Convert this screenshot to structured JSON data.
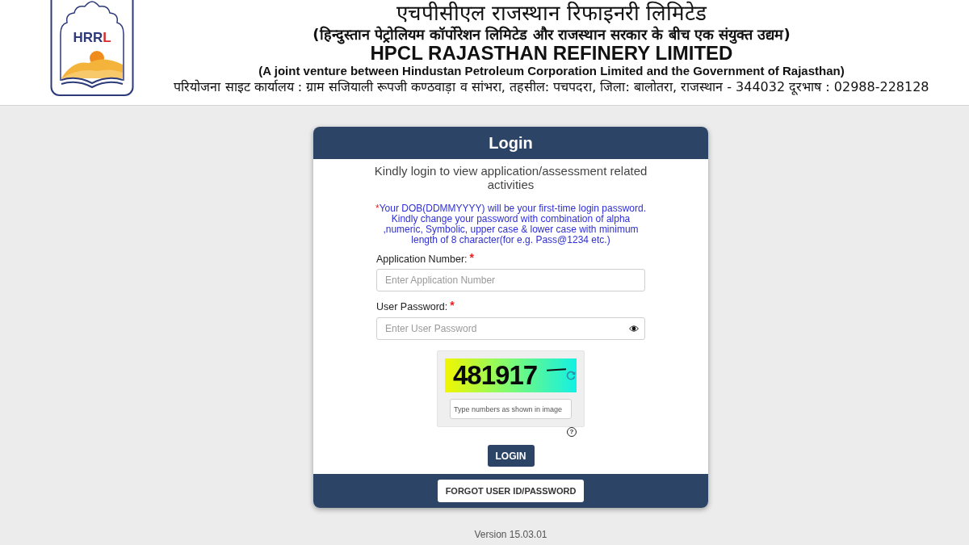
{
  "header": {
    "logo": {
      "text_parts": [
        {
          "text": "HRR",
          "color": "#2e3b7a"
        },
        {
          "text": "L",
          "color": "#d92b2b"
        }
      ]
    },
    "lines": [
      {
        "kind": "hindi_title",
        "text": "एचपीसीएल राजस्थान रिफाइनरी लिमिटेड"
      },
      {
        "kind": "hindi_subtitle",
        "text": "(हिन्दुस्तान पेट्रोलियम कॉर्पोरेशन लिमिटेड और राजस्थान सरकार के बीच एक संयुक्त उद्यम)"
      },
      {
        "kind": "english_title",
        "text": "HPCL RAJASTHAN REFINERY LIMITED"
      },
      {
        "kind": "english_subtitle",
        "text": "(A joint venture between Hindustan Petroleum Corporation Limited and the Government of Rajasthan)"
      },
      {
        "kind": "address",
        "text": "परियोजना साइट कार्यालय : ग्राम सजियाली रूपजी कण्ठवाड़ा व सांभरा, तहसील: पचपदरा, जिला: बालोतरा, राजस्थान - 344032  दूरभाष : 02988-228128"
      }
    ]
  },
  "login": {
    "title": "Login",
    "intro": "Kindly login to view application/assessment related activities",
    "note": {
      "marker": "*",
      "text": "Your DOB(DDMMYYYY) will be your first-time login password. Kindly change your password with combination of alpha ,numeric, Symbolic, upper case & lower case with minimum length of 8 character(for e.g. Pass@1234 etc.)"
    },
    "fields": [
      {
        "kind": "text",
        "label": "Application Number:",
        "required_mark": "*",
        "placeholder": "Enter Application Number"
      },
      {
        "kind": "password",
        "label": "User Password:",
        "required_mark": "*",
        "placeholder": "Enter User Password"
      }
    ],
    "captcha": {
      "code": "481917",
      "placeholder": "Type numbers as shown in image",
      "help": "?"
    },
    "submit": "LOGIN",
    "forgot": "FORGOT USER ID/PASSWORD"
  },
  "version": "Version 15.03.01"
}
